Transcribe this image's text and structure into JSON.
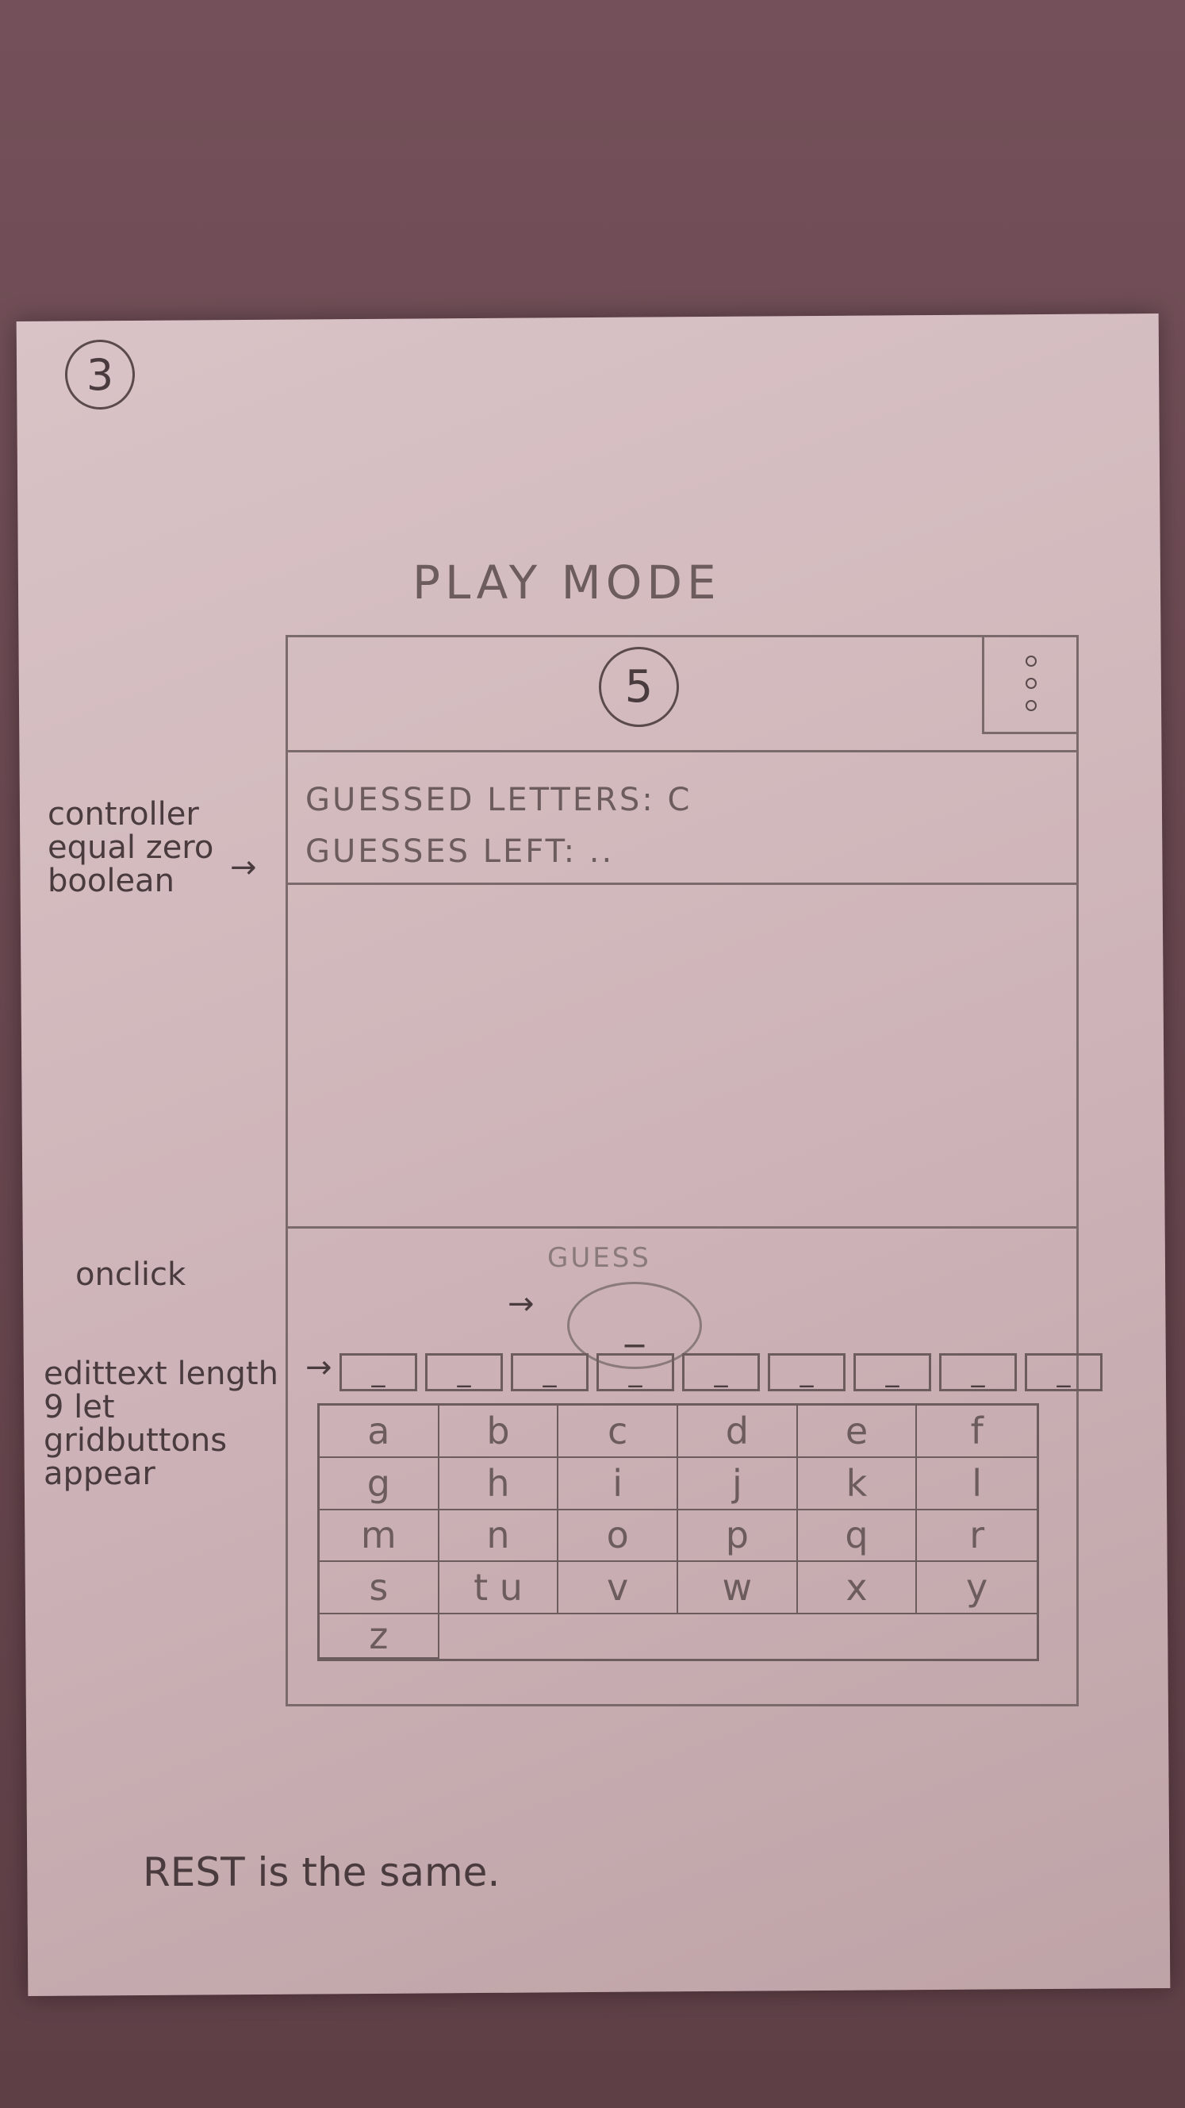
{
  "page_number": "3",
  "title": "PLAY MODE",
  "header": {
    "logo_digit": "5"
  },
  "status": {
    "guessed_letters": "GUESSED LETTERS: C",
    "guesses_left": "GUESSES LEFT: .."
  },
  "guess": {
    "label": "GUESS",
    "value": "_"
  },
  "slots": [
    "_",
    "_",
    "_",
    "_",
    "_",
    "_",
    "_",
    "_",
    "_"
  ],
  "keyboard": [
    "a",
    "b",
    "c",
    "d",
    "e",
    "f",
    "g",
    "h",
    "i",
    "j",
    "k",
    "l",
    "m",
    "n",
    "o",
    "p",
    "q",
    "r",
    "s",
    "t u",
    "v",
    "w",
    "x",
    "y",
    "z"
  ],
  "notes": {
    "controller": "controller equal zero boolean",
    "onclick": "onclick",
    "edittext": "edittext length 9 let gridbuttons appear"
  },
  "footer": "REST is the same."
}
